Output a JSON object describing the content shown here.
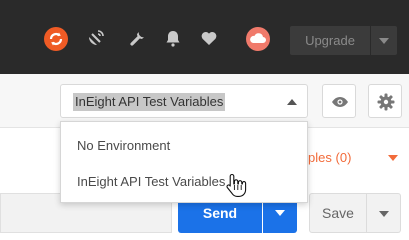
{
  "header": {
    "upgrade_label": "Upgrade",
    "icons": [
      "sync-icon",
      "satellite-icon",
      "wrench-icon",
      "bell-icon",
      "heart-icon",
      "cloud-icon",
      "chevron-down-icon"
    ]
  },
  "environment": {
    "selected": "InEight API Test Variables",
    "options": [
      "No Environment",
      "InEight API Test Variables"
    ]
  },
  "request": {
    "examples_label": "amples (0)",
    "send_label": "Send",
    "save_label": "Save"
  },
  "colors": {
    "header_bg": "#2a2a2a",
    "accent_orange": "#ef5b25",
    "send_blue": "#1b72e8",
    "examples_orange": "#f26b3a"
  }
}
